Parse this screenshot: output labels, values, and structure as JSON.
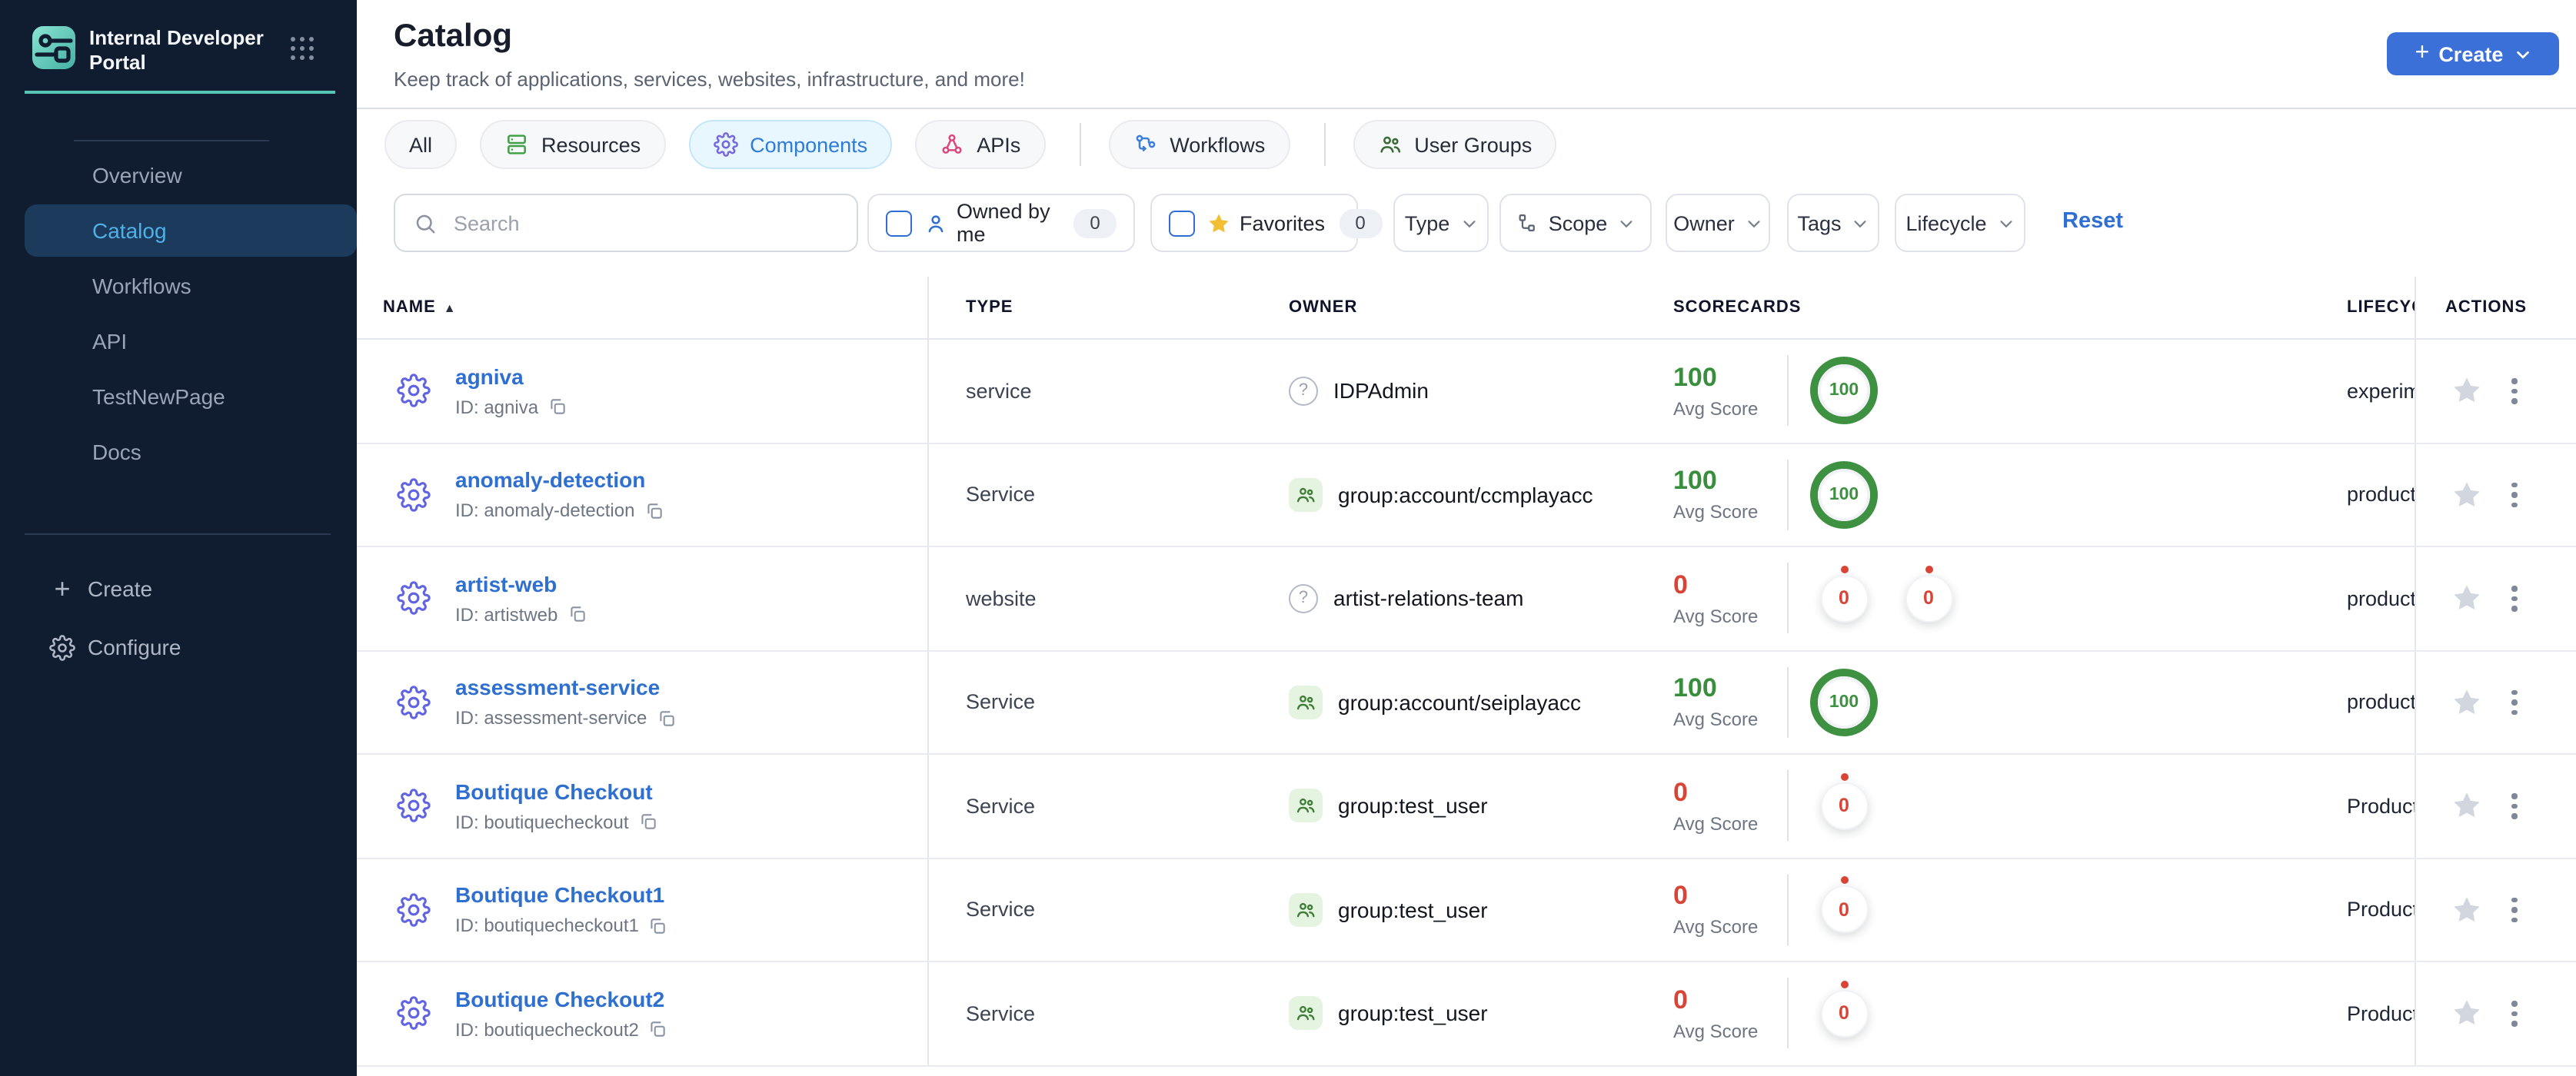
{
  "sidebar": {
    "brand": {
      "title": "Internal Developer Portal"
    },
    "nav": [
      {
        "label": "Overview",
        "active": false
      },
      {
        "label": "Catalog",
        "active": true
      },
      {
        "label": "Workflows",
        "active": false
      },
      {
        "label": "API",
        "active": false
      },
      {
        "label": "TestNewPage",
        "active": false
      },
      {
        "label": "Docs",
        "active": false
      }
    ],
    "create_label": "Create",
    "configure_label": "Configure"
  },
  "header": {
    "title": "Catalog",
    "subtitle": "Keep track of applications, services, websites, infrastructure, and more!",
    "create_label": "Create"
  },
  "tabs": [
    {
      "label": "All",
      "icon": null,
      "active": false
    },
    {
      "label": "Resources",
      "icon": "resources-icon",
      "icon_color": "#43a047",
      "active": false
    },
    {
      "label": "Components",
      "icon": "gear-icon",
      "icon_color": "#7468e0",
      "active": true
    },
    {
      "label": "APIs",
      "icon": "api-nodes-icon",
      "icon_color": "#d9487f",
      "active": false
    },
    {
      "label": "Workflows",
      "icon": "workflow-icon",
      "icon_color": "#3d7fd8",
      "active": false
    },
    {
      "label": "User Groups",
      "icon": "user-groups-icon",
      "icon_color": "#3a6b35",
      "active": false
    }
  ],
  "filters": {
    "search_placeholder": "Search",
    "owned_by_me": {
      "label": "Owned by me",
      "count": "0",
      "checked": false,
      "icon": "person-icon"
    },
    "favorites": {
      "label": "Favorites",
      "count": "0",
      "checked": false,
      "icon": "star-icon",
      "star_color": "#f0bf34"
    },
    "dropdowns": [
      {
        "label": "Type"
      },
      {
        "label": "Scope",
        "icon": "hierarchy-icon"
      },
      {
        "label": "Owner"
      },
      {
        "label": "Tags"
      },
      {
        "label": "Lifecycle"
      }
    ],
    "reset_label": "Reset"
  },
  "labels": {
    "avg_score": "Avg Score"
  },
  "table": {
    "columns": {
      "name": "NAME",
      "type": "TYPE",
      "owner": "OWNER",
      "scorecards": "SCORECARDS",
      "lifecycle": "LIFECYCLE",
      "actions": "ACTIONS"
    },
    "sort": {
      "column": "NAME",
      "direction": "ascending"
    },
    "rows": [
      {
        "name": "agniva",
        "id": "ID: agniva",
        "type": "service",
        "owner": "IDPAdmin",
        "owner_kind": "user",
        "avg": "100",
        "scores": [
          "100"
        ],
        "lifecycle": "experimental"
      },
      {
        "name": "anomaly-detection",
        "id": "ID: anomaly-detection",
        "type": "Service",
        "owner": "group:account/ccmplayacc",
        "owner_kind": "group",
        "avg": "100",
        "scores": [
          "100"
        ],
        "lifecycle": "production"
      },
      {
        "name": "artist-web",
        "id": "ID: artistweb",
        "type": "website",
        "owner": "artist-relations-team",
        "owner_kind": "user",
        "avg": "0",
        "scores": [
          "0",
          "0"
        ],
        "lifecycle": "production"
      },
      {
        "name": "assessment-service",
        "id": "ID: assessment-service",
        "type": "Service",
        "owner": "group:account/seiplayacc",
        "owner_kind": "group",
        "avg": "100",
        "scores": [
          "100"
        ],
        "lifecycle": "production"
      },
      {
        "name": "Boutique Checkout",
        "id": "ID: boutiquecheckout",
        "type": "Service",
        "owner": "group:test_user",
        "owner_kind": "group",
        "avg": "0",
        "scores": [
          "0"
        ],
        "lifecycle": "Production"
      },
      {
        "name": "Boutique Checkout1",
        "id": "ID: boutiquecheckout1",
        "type": "Service",
        "owner": "group:test_user",
        "owner_kind": "group",
        "avg": "0",
        "scores": [
          "0"
        ],
        "lifecycle": "Production"
      },
      {
        "name": "Boutique Checkout2",
        "id": "ID: boutiquecheckout2",
        "type": "Service",
        "owner": "group:test_user",
        "owner_kind": "group",
        "avg": "0",
        "scores": [
          "0"
        ],
        "lifecycle": "Production"
      }
    ]
  },
  "colors": {
    "sidebar_bg": "#101d31",
    "sidebar_active_bg": "#1c3a5c",
    "sidebar_active_text": "#4fb0e8",
    "accent_teal": "#57c3b4",
    "primary_blue": "#3b70d8",
    "link_blue": "#2e6fd0",
    "score_green": "#388e3c",
    "score_red": "#d84436",
    "group_badge_bg": "#e5f3e1",
    "group_badge_fg": "#3f7d36",
    "active_tab_bg": "#e8f6fd",
    "active_tab_text": "#2f7bd9"
  }
}
